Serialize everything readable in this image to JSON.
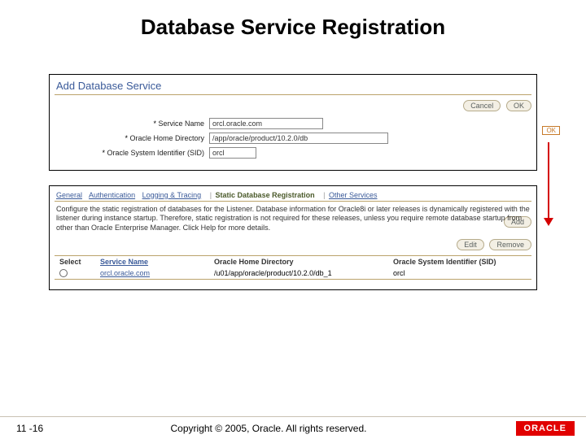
{
  "slide_title": "Database Service Registration",
  "add_panel": {
    "heading": "Add Database Service",
    "cancel_label": "Cancel",
    "ok_label": "OK",
    "fields": {
      "service_name_label": "Service Name",
      "service_name_value": "orcl.oracle.com",
      "oracle_home_label": "Oracle Home Directory",
      "oracle_home_value": "/app/oracle/product/10.2.0/db",
      "sid_label": "Oracle System Identifier (SID)",
      "sid_value": "orcl"
    }
  },
  "ok_badge": "OK",
  "reg_panel": {
    "tabs": {
      "general": "General",
      "auth": "Authentication",
      "logtrace": "Logging & Tracing",
      "static": "Static Database Registration",
      "other": "Other Services"
    },
    "description": "Configure the static registration of databases for the Listener. Database information for Oracle8i or later releases is dynamically registered with the listener during instance startup. Therefore, static registration is not required for these releases, unless you require remote database startup from other than Oracle Enterprise Manager. Click Help for more details.",
    "buttons": {
      "edit": "Edit",
      "remove": "Remove",
      "add": "Add"
    },
    "table": {
      "headers": {
        "select": "Select",
        "service": "Service Name",
        "home": "Oracle Home Directory",
        "sid": "Oracle System Identifier (SID)"
      },
      "row": {
        "service": "orcl.oracle.com",
        "home": "/u01/app/oracle/product/10.2.0/db_1",
        "sid": "orcl"
      }
    }
  },
  "footer": {
    "page": "11 -16",
    "copyright": "Copyright © 2005, Oracle. All rights reserved.",
    "logo": "ORACLE"
  }
}
